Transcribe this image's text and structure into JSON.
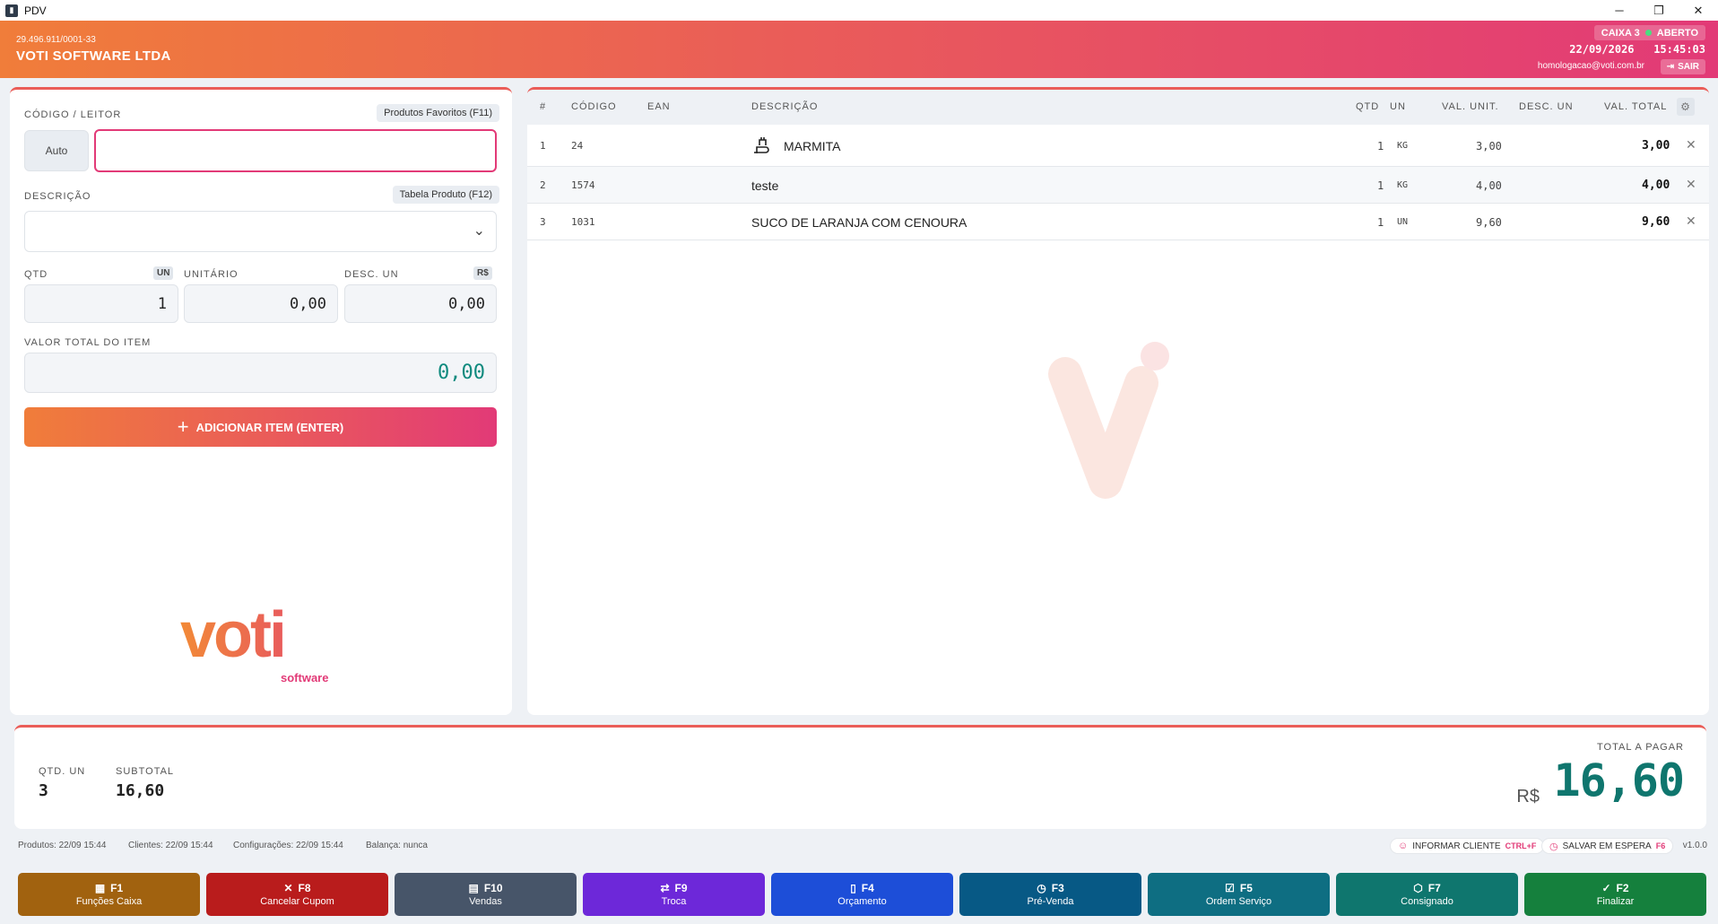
{
  "window": {
    "title": "PDV"
  },
  "header": {
    "cnpj": "29.496.911/0001-33",
    "company": "VOTI SOFTWARE LTDA",
    "caixa": "CAIXA 3",
    "status": "ABERTO",
    "date": "22/09/2026",
    "time": "15:45:03",
    "email": "homologacao@voti.com.br",
    "logout": "SAIR"
  },
  "form": {
    "codigo_label": "CÓDIGO / LEITOR",
    "favoritos_button": "Produtos Favoritos (F11)",
    "auto_button": "Auto",
    "codigo_value": "",
    "descricao_label": "DESCRIÇÃO",
    "tabela_button": "Tabela Produto (F12)",
    "descricao_value": "",
    "qtd_label": "QTD",
    "qtd_unit": "UN",
    "qtd_value": "1",
    "unitario_label": "UNITÁRIO",
    "unitario_value": "0,00",
    "desc_label": "DESC. UN",
    "desc_unit": "R$",
    "desc_value": "0,00",
    "total_label": "VALOR TOTAL DO ITEM",
    "total_value": "0,00",
    "add_button": "ADICIONAR ITEM (ENTER)"
  },
  "logo": {
    "text": "voti",
    "sub": "software"
  },
  "table": {
    "headers": {
      "num": "#",
      "codigo": "CÓDIGO",
      "ean": "EAN",
      "descricao": "DESCRIÇÃO",
      "qtd": "QTD",
      "un": "UN",
      "val_unit": "VAL. UNIT.",
      "desc_un": "DESC. UN",
      "val_total": "VAL. TOTAL"
    },
    "rows": [
      {
        "num": "1",
        "codigo": "24",
        "ean": "",
        "descricao": "MARMITA",
        "qtd": "1",
        "un": "KG",
        "val_unit": "3,00",
        "desc_un": "",
        "val_total": "3,00"
      },
      {
        "num": "2",
        "codigo": "1574",
        "ean": "",
        "descricao": "teste",
        "qtd": "1",
        "un": "KG",
        "val_unit": "4,00",
        "desc_un": "",
        "val_total": "4,00"
      },
      {
        "num": "3",
        "codigo": "1031",
        "ean": "",
        "descricao": "SUCO DE LARANJA COM CENOURA",
        "qtd": "1",
        "un": "UN",
        "val_unit": "9,60",
        "desc_un": "",
        "val_total": "9,60"
      }
    ]
  },
  "summary": {
    "qtd_label": "QTD. UN",
    "qtd_value": "3",
    "subtotal_label": "SUBTOTAL",
    "subtotal_value": "16,60",
    "total_label": "TOTAL A PAGAR",
    "currency": "R$",
    "total_value": "16,60"
  },
  "statusbar": {
    "produtos": "Produtos: 22/09 15:44",
    "clientes": "Clientes: 22/09 15:44",
    "configuracoes": "Configurações: 22/09 15:44",
    "balanca": "Balança: nunca",
    "informar_cliente": "INFORMAR CLIENTE",
    "informar_cliente_key": "CTRL+F",
    "salvar_espera": "SALVAR EM ESPERA",
    "salvar_espera_key": "F6",
    "version": "v1.0.0"
  },
  "fkeys": [
    {
      "key": "F1",
      "label": "Funções Caixa",
      "color": "#a1620f",
      "icon": "grid-icon"
    },
    {
      "key": "F8",
      "label": "Cancelar Cupom",
      "color": "#b91c1c",
      "icon": "x-icon"
    },
    {
      "key": "F10",
      "label": "Vendas",
      "color": "#475569",
      "icon": "receipt-icon"
    },
    {
      "key": "F9",
      "label": "Troca",
      "color": "#6d28d9",
      "icon": "swap-icon"
    },
    {
      "key": "F4",
      "label": "Orçamento",
      "color": "#1d4ed8",
      "icon": "document-icon"
    },
    {
      "key": "F3",
      "label": "Pré-Venda",
      "color": "#075985",
      "icon": "clock-icon"
    },
    {
      "key": "F5",
      "label": "Ordem Serviço",
      "color": "#0e6e82",
      "icon": "clipboard-check-icon"
    },
    {
      "key": "F7",
      "label": "Consignado",
      "color": "#0f766e",
      "icon": "box-icon"
    },
    {
      "key": "F2",
      "label": "Finalizar",
      "color": "#15803d",
      "icon": "check-icon"
    }
  ]
}
